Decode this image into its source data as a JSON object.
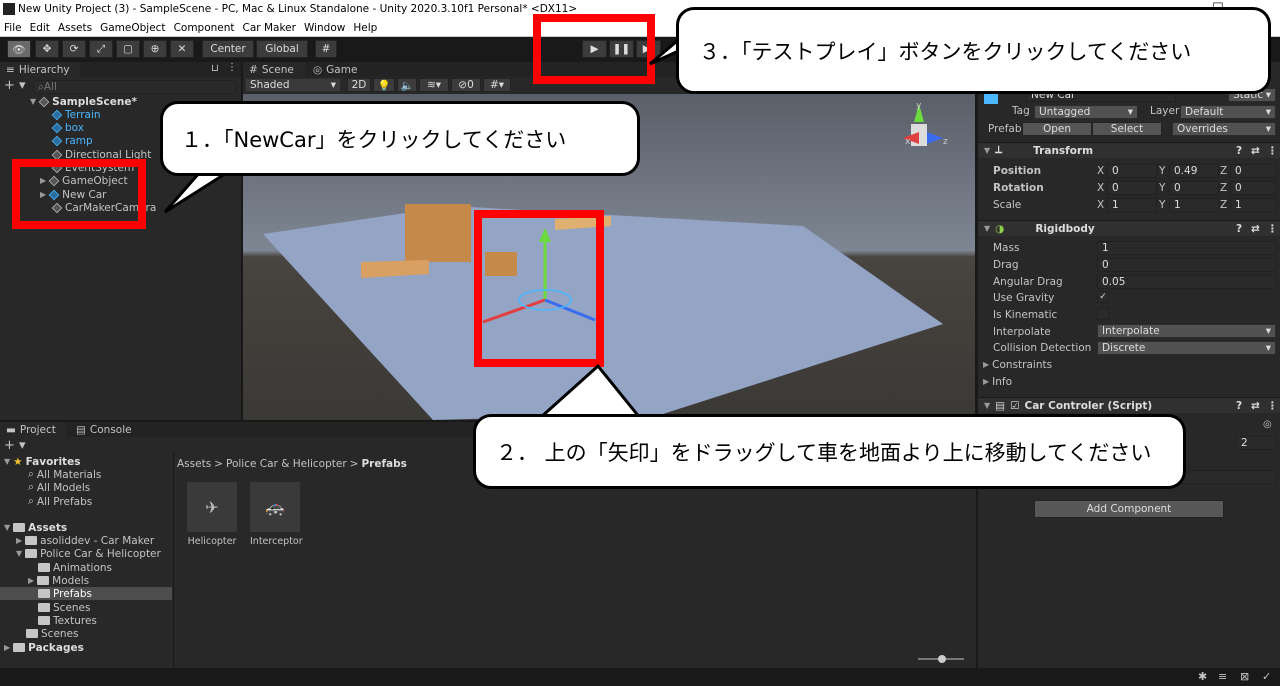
{
  "window": {
    "title": "New Unity Project (3) - SampleScene - PC, Mac & Linux Standalone - Unity 2020.3.10f1 Personal* <DX11>",
    "minimize": "—",
    "maximize": "☐"
  },
  "menu": [
    "File",
    "Edit",
    "Assets",
    "GameObject",
    "Component",
    "Car Maker",
    "Window",
    "Help"
  ],
  "toolbar": {
    "center": "Center",
    "global": "Global"
  },
  "hierarchy": {
    "tab": "Hierarchy",
    "search_placeholder": "All",
    "scene": "SampleScene*",
    "items": [
      "Terrain",
      "box",
      "ramp",
      "Directional Light",
      "EventSystem",
      "GameObject",
      "New Car",
      "CarMakerCamera"
    ]
  },
  "scene_view": {
    "tab_scene": "Scene",
    "tab_game": "Game",
    "shading": "Shaded",
    "mode_2d": "2D",
    "gizmo_count": "0",
    "axis_y": "y",
    "axis_x": "x",
    "axis_z": "z"
  },
  "inspector": {
    "object_name": "New Car",
    "static_label": "Static",
    "tag_label": "Tag",
    "tag_value": "Untagged",
    "layer_label": "Layer",
    "layer_value": "Default",
    "prefab_label": "Prefab",
    "open": "Open",
    "select": "Select",
    "overrides": "Overrides",
    "transform": {
      "title": "Transform",
      "position": {
        "label": "Position",
        "x": "0",
        "y": "0.49",
        "z": "0"
      },
      "rotation": {
        "label": "Rotation",
        "x": "0",
        "y": "0",
        "z": "0"
      },
      "scale": {
        "label": "Scale",
        "x": "1",
        "y": "1",
        "z": "1"
      }
    },
    "rigidbody": {
      "title": "Rigidbody",
      "mass_label": "Mass",
      "mass": "1",
      "drag_label": "Drag",
      "drag": "0",
      "angular_drag_label": "Angular Drag",
      "angular_drag": "0.05",
      "use_gravity_label": "Use Gravity",
      "is_kinematic_label": "Is Kinematic",
      "interpolate_label": "Interpolate",
      "interpolate": "Interpolate",
      "collision_label": "Collision Detection",
      "collision": "Discrete",
      "constraints": "Constraints",
      "info": "Info"
    },
    "script": {
      "title": "Car Controler (Script)",
      "value": "2"
    },
    "add_component": "Add Component"
  },
  "project": {
    "tab_project": "Project",
    "tab_console": "Console",
    "favorites": "Favorites",
    "fav_items": [
      "All Materials",
      "All Models",
      "All Prefabs"
    ],
    "assets": "Assets",
    "folders": [
      "asoliddev - Car Maker",
      "Police Car & Helicopter",
      "Animations",
      "Models",
      "Prefabs",
      "Scenes",
      "Textures",
      "Scenes"
    ],
    "packages": "Packages",
    "breadcrumb": [
      "Assets",
      "Police Car & Helicopter",
      "Prefabs"
    ],
    "breadcrumb_sep": ">",
    "prefabs": [
      "Helicopter",
      "Interceptor"
    ]
  },
  "callouts": {
    "step1": "１．「NewCar」をクリックしてください",
    "step2": "２． 上の「矢印」をドラッグして車を地面より上に移動してください",
    "step3": "３．「テストプレイ」ボタンをクリックしてください"
  },
  "colors": {
    "highlight": "#ff0000",
    "selection": "#2c5d87",
    "unity_blue": "#4ab7ff"
  }
}
